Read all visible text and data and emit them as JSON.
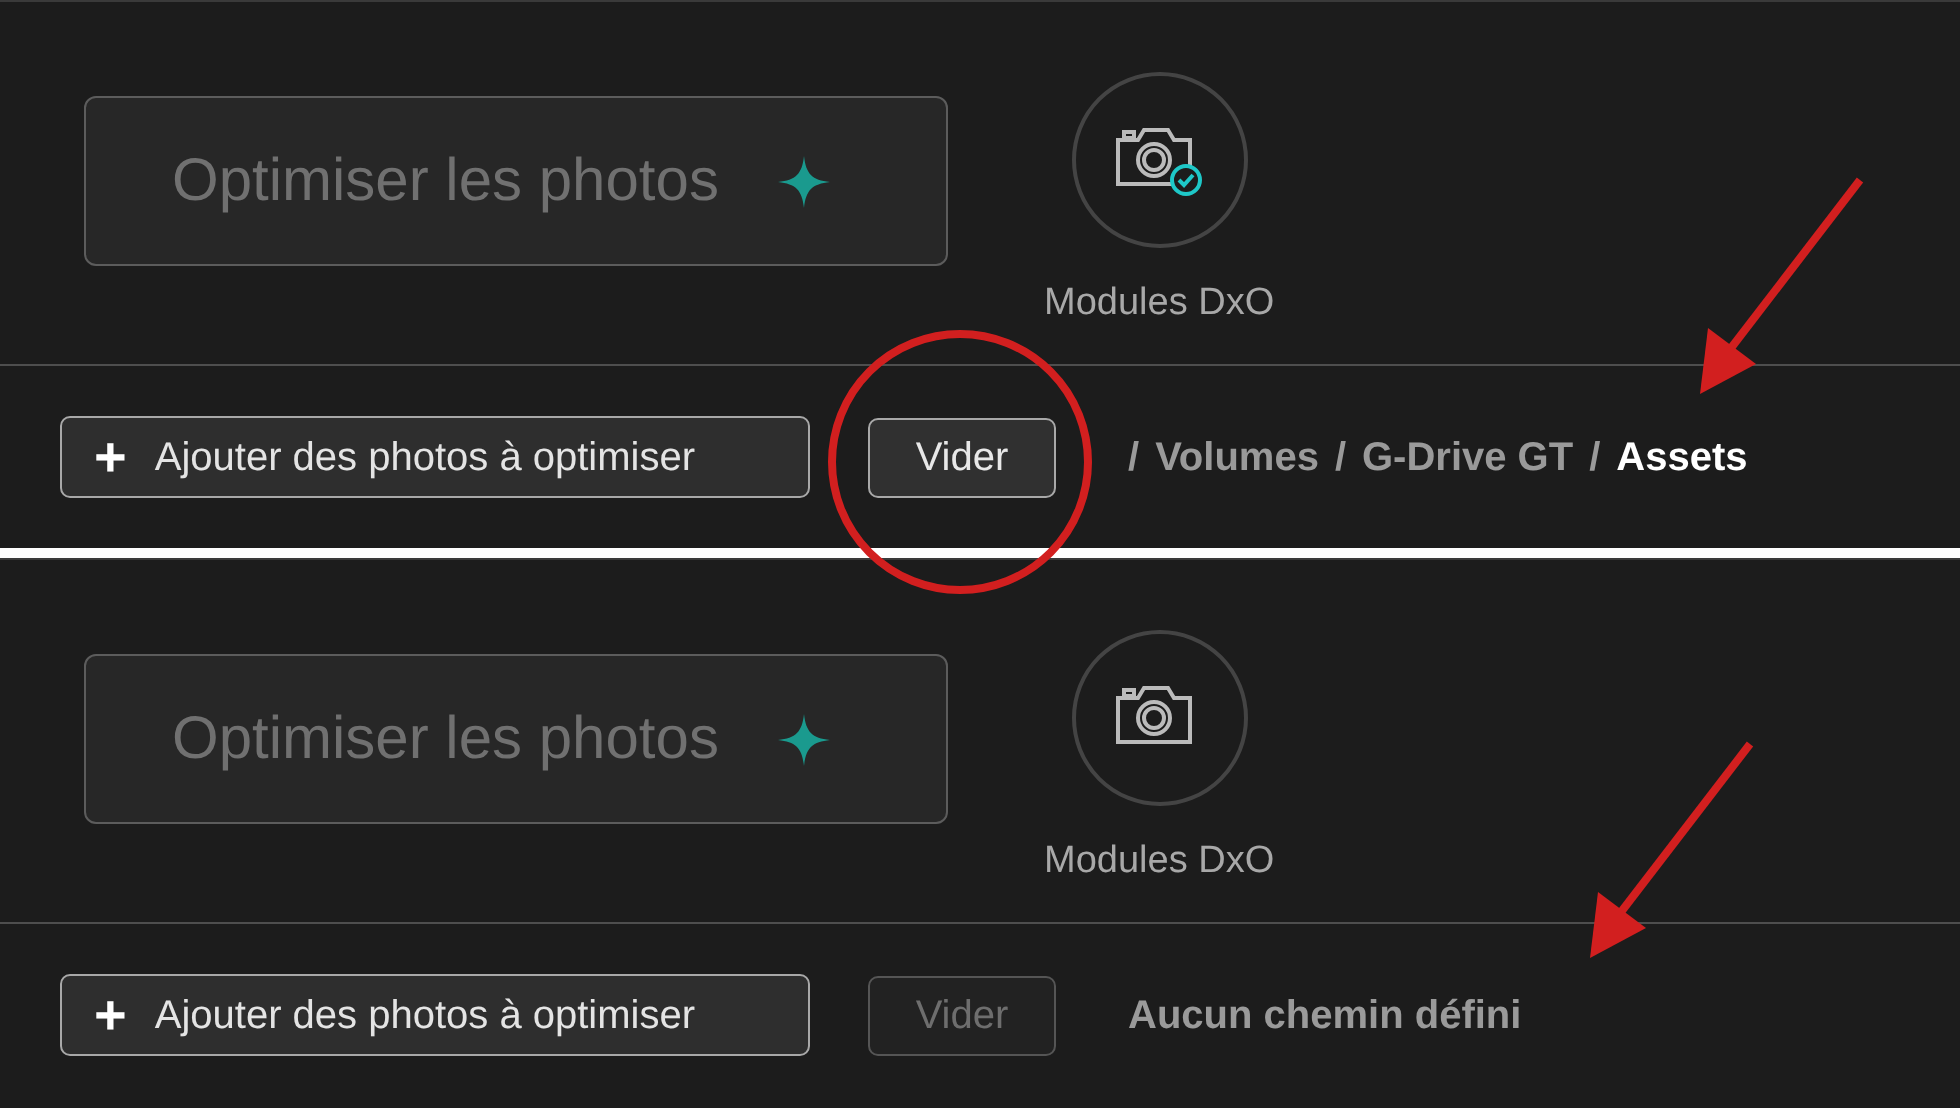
{
  "panels": [
    {
      "optimize_button": {
        "label": "Optimiser les photos"
      },
      "modules": {
        "label": "Modules DxO",
        "checked": true
      },
      "add_button": {
        "icon": "+",
        "label": "Ajouter des photos à optimiser"
      },
      "clear_button": {
        "label": "Vider",
        "disabled": false,
        "circled": true
      },
      "path": {
        "kind": "breadcrumb",
        "items": [
          {
            "kind": "separator",
            "text": "/"
          },
          {
            "kind": "segment",
            "text": "Volumes",
            "current": false
          },
          {
            "kind": "separator",
            "text": "/"
          },
          {
            "kind": "segment",
            "text": "G-Drive GT",
            "current": false
          },
          {
            "kind": "separator",
            "text": "/"
          },
          {
            "kind": "segment",
            "text": "Assets",
            "current": true
          }
        ]
      },
      "arrow_to_path": true
    },
    {
      "optimize_button": {
        "label": "Optimiser les photos"
      },
      "modules": {
        "label": "Modules DxO",
        "checked": false
      },
      "add_button": {
        "icon": "+",
        "label": "Ajouter des photos à optimiser"
      },
      "clear_button": {
        "label": "Vider",
        "disabled": true,
        "circled": false
      },
      "path": {
        "kind": "message",
        "text": "Aucun chemin défini"
      },
      "arrow_to_path": true
    }
  ]
}
